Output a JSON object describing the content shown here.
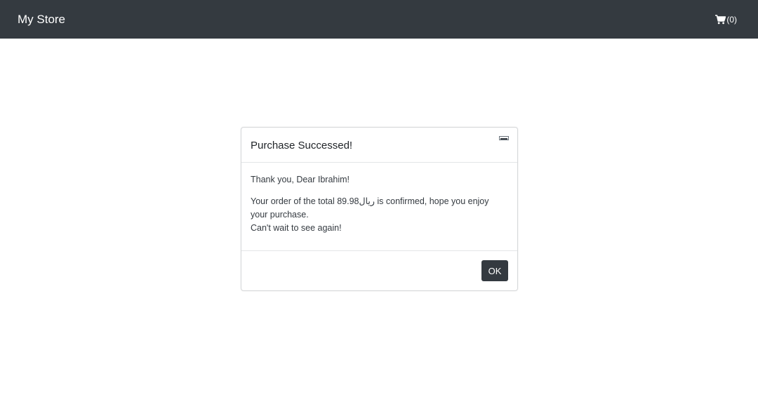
{
  "navbar": {
    "brand": "My Store",
    "cart_count": "(0)",
    "cart_icon": "shopping-cart-icon"
  },
  "modal": {
    "title": "Purchase Successed!",
    "close_icon": "close-icon",
    "greeting": "Thank you, Dear Ibrahim!",
    "message_part1": "Your order of the total 89.98",
    "currency": "ريال",
    "message_part2": " is confirmed, hope you enjoy your purchase.",
    "farewell": "Can't wait to see again!",
    "ok_label": "OK"
  },
  "colors": {
    "navbar_bg": "#343a40",
    "button_bg": "#343a40",
    "text": "#212529"
  }
}
